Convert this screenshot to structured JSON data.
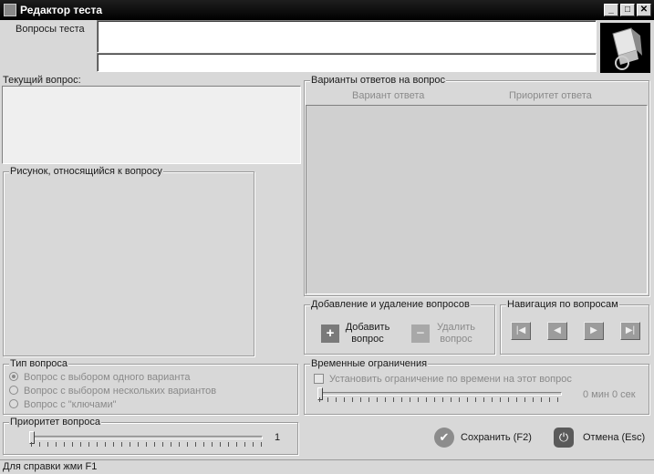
{
  "window": {
    "title": "Редактор теста",
    "controls": {
      "minimize": "_",
      "maximize": "□",
      "close": "✕"
    }
  },
  "questions_label": "Вопросы теста",
  "current_question_label": "Текущий вопрос:",
  "picture_group_label": "Рисунок, относящийся к вопросу",
  "answers_group": {
    "label": "Варианты ответов на вопрос",
    "columns": [
      "Вариант ответа",
      "Приоритет ответа"
    ]
  },
  "add_remove_group": {
    "label": "Добавление и удаление вопросов",
    "add_label": "Добавить вопрос",
    "remove_label": "Удалить вопрос"
  },
  "navigation_group": {
    "label": "Навигация по вопросам",
    "buttons": [
      "first",
      "previous",
      "next",
      "last"
    ]
  },
  "question_type_group": {
    "label": "Тип вопроса",
    "options": [
      "Вопрос с выбором одного варианта",
      "Вопрос с выбором нескольких вариантов",
      "Вопрос с \"ключами\""
    ],
    "selected_index": 0
  },
  "time_limits_group": {
    "label": "Временные ограничения",
    "checkbox_label": "Установить ограничение по времени на этот вопрос",
    "checked": false,
    "time_value": "0 мин 0 сек"
  },
  "priority_group": {
    "label": "Приоритет вопроса",
    "value": "1"
  },
  "footer": {
    "save_label": "Сохранить (F2)",
    "cancel_label": "Отмена (Esc)"
  },
  "status_text": "Для справки жми F1",
  "icons": {
    "app": "window-icon",
    "logo": "computer-logo-icon",
    "add": "plus-icon",
    "remove": "minus-icon",
    "save": "checkmark-icon",
    "cancel": "power-icon"
  }
}
